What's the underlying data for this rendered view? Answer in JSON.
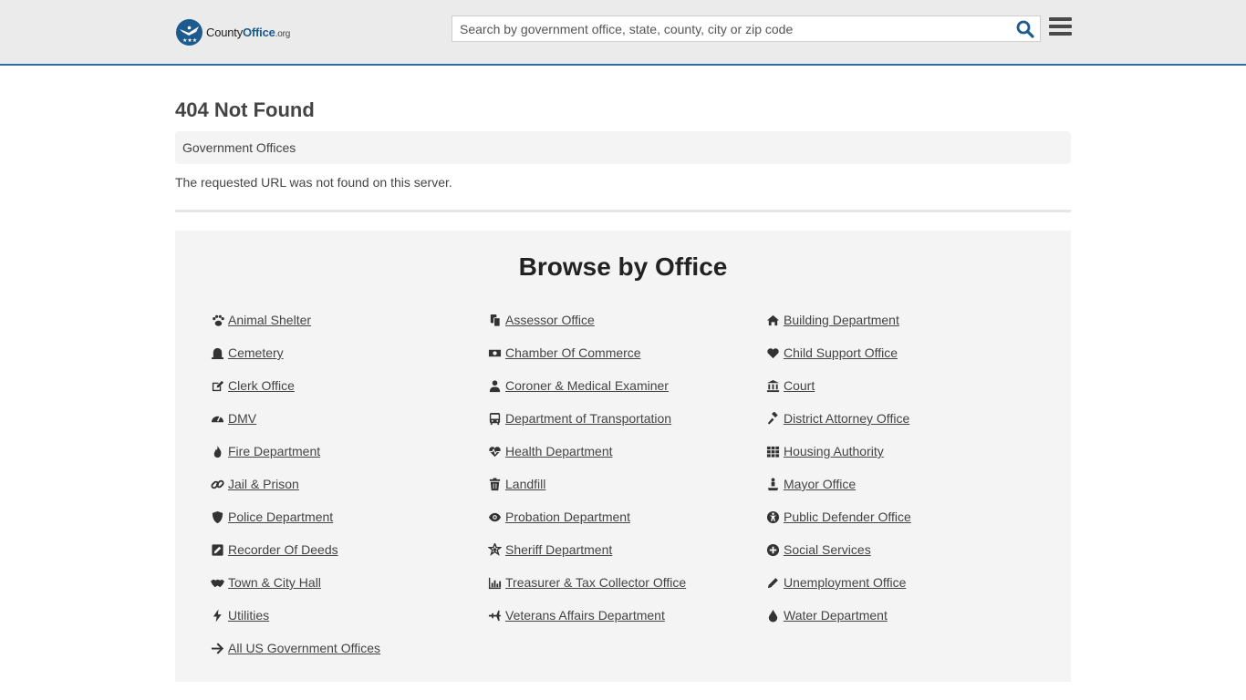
{
  "header": {
    "logo_main": "County",
    "logo_bold": "Office",
    "logo_tld": ".org",
    "search_placeholder": "Search by government office, state, county, city or zip code"
  },
  "page": {
    "title": "404 Not Found",
    "breadcrumb": "Government Offices",
    "message": "The requested URL was not found on this server."
  },
  "browse": {
    "title": "Browse by Office",
    "items": [
      {
        "label": "Animal Shelter",
        "icon": "paw-icon"
      },
      {
        "label": "Assessor Office",
        "icon": "copy-icon"
      },
      {
        "label": "Building Department",
        "icon": "home-icon"
      },
      {
        "label": "Cemetery",
        "icon": "tombstone-icon"
      },
      {
        "label": "Chamber Of Commerce",
        "icon": "money-icon"
      },
      {
        "label": "Child Support Office",
        "icon": "heart-icon"
      },
      {
        "label": "Clerk Office",
        "icon": "edit-icon"
      },
      {
        "label": "Coroner & Medical Examiner",
        "icon": "user-md-icon"
      },
      {
        "label": "Court",
        "icon": "courthouse-icon"
      },
      {
        "label": "DMV",
        "icon": "speedometer-icon"
      },
      {
        "label": "Department of Transportation",
        "icon": "bus-icon"
      },
      {
        "label": "District Attorney Office",
        "icon": "gavel-icon"
      },
      {
        "label": "Fire Department",
        "icon": "fire-icon"
      },
      {
        "label": "Health Department",
        "icon": "heartbeat-icon"
      },
      {
        "label": "Housing Authority",
        "icon": "grid-icon"
      },
      {
        "label": "Jail & Prison",
        "icon": "chain-link-icon"
      },
      {
        "label": "Landfill",
        "icon": "trash-icon"
      },
      {
        "label": "Mayor Office",
        "icon": "podium-icon"
      },
      {
        "label": "Police Department",
        "icon": "shield-icon"
      },
      {
        "label": "Probation Department",
        "icon": "eye-icon"
      },
      {
        "label": "Public Defender Office",
        "icon": "universal-access-icon"
      },
      {
        "label": "Recorder Of Deeds",
        "icon": "pen-square-icon"
      },
      {
        "label": "Sheriff Department",
        "icon": "sheriff-star-icon"
      },
      {
        "label": "Social Services",
        "icon": "plus-circle-icon"
      },
      {
        "label": "Town & City Hall",
        "icon": "handshake-icon"
      },
      {
        "label": "Treasurer & Tax Collector Office",
        "icon": "bar-chart-icon"
      },
      {
        "label": "Unemployment Office",
        "icon": "pencil-icon"
      },
      {
        "label": "Utilities",
        "icon": "bolt-icon"
      },
      {
        "label": "Veterans Affairs Department",
        "icon": "plane-icon"
      },
      {
        "label": "Water Department",
        "icon": "tint-icon"
      },
      {
        "label": " All US Government Offices",
        "icon": "arrow-right-icon"
      }
    ]
  }
}
